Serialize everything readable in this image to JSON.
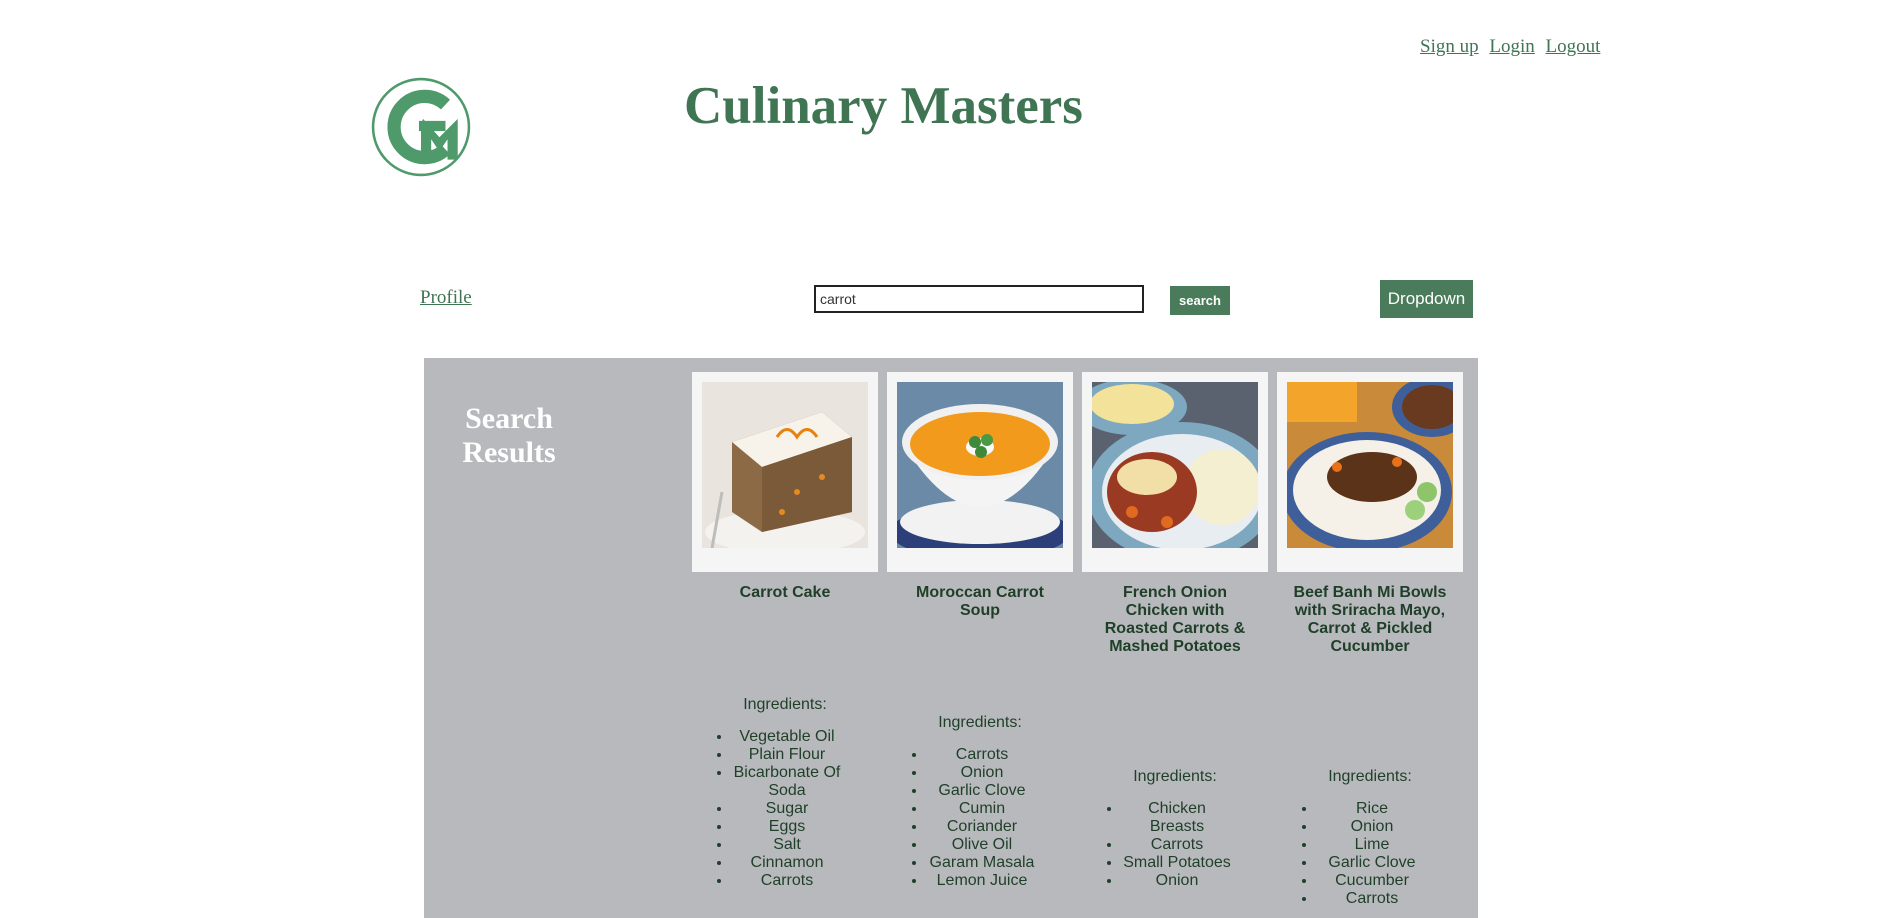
{
  "header": {
    "links": [
      "Sign up",
      "Login",
      "Logout"
    ],
    "title": "Culinary Masters",
    "logo_icon": "gm-monogram-icon"
  },
  "nav": {
    "profile_label": "Profile",
    "search_value": "carrot",
    "search_button_label": "search",
    "dropdown_label": "Dropdown"
  },
  "results": {
    "heading": "Search Results",
    "recipes": [
      {
        "name": "Carrot Cake",
        "photo": "carrot-cake-photo",
        "ingredients_label": "Ingredients:",
        "ingredients": [
          "Vegetable Oil",
          "Plain Flour",
          "Bicarbonate Of Soda",
          "Sugar",
          "Eggs",
          "Salt",
          "Cinnamon",
          "Carrots"
        ]
      },
      {
        "name": "Moroccan Carrot Soup",
        "photo": "carrot-soup-photo",
        "ingredients_label": "Ingredients:",
        "ingredients": [
          "Carrots",
          "Onion",
          "Garlic Clove",
          "Cumin",
          "Coriander",
          "Olive Oil",
          "Garam Masala",
          "Lemon Juice"
        ]
      },
      {
        "name": "French Onion Chicken with Roasted Carrots & Mashed Potatoes",
        "photo": "chicken-carrots-potatoes-photo",
        "ingredients_label": "Ingredients:",
        "ingredients": [
          "Chicken Breasts",
          "Carrots",
          "Small Potatoes",
          "Onion"
        ]
      },
      {
        "name": "Beef Banh Mi Bowls with Sriracha Mayo, Carrot & Pickled Cucumber",
        "photo": "beef-banh-mi-bowl-photo",
        "ingredients_label": "Ingredients:",
        "ingredients": [
          "Rice",
          "Onion",
          "Lime",
          "Garlic Clove",
          "Cucumber",
          "Carrots"
        ]
      }
    ]
  },
  "colors": {
    "brand_green": "#3f7553",
    "button_green": "#4a7b5a",
    "panel_gray": "#b8b9bc"
  }
}
